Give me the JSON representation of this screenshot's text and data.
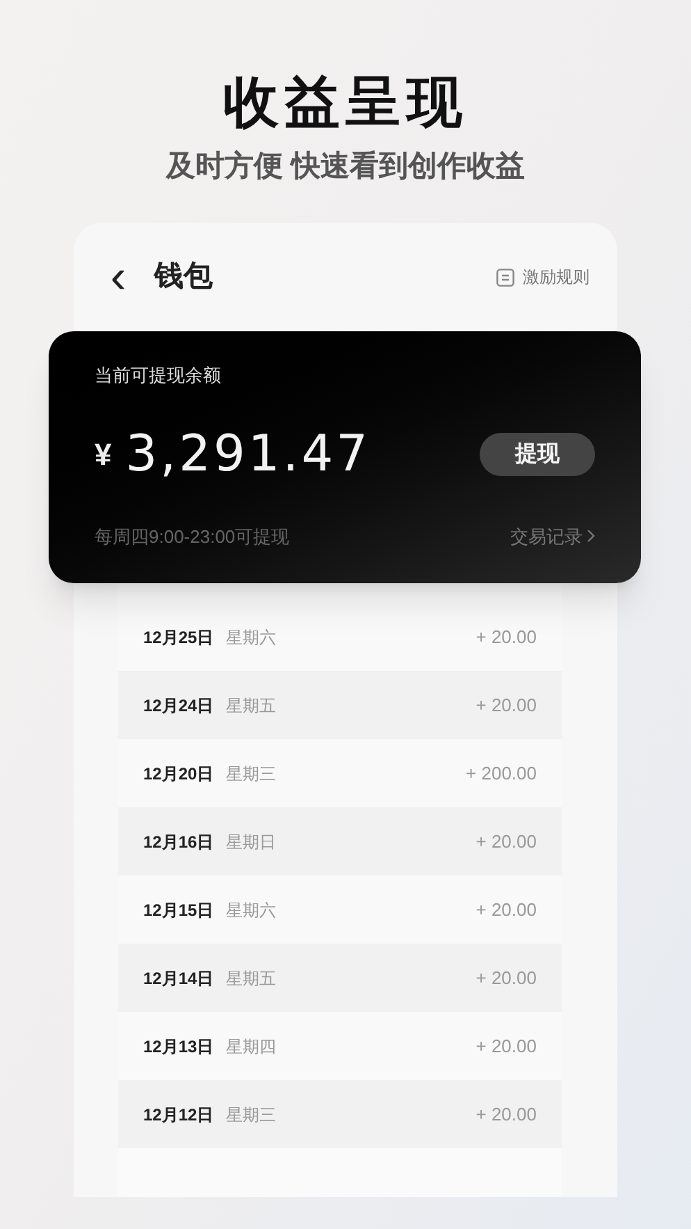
{
  "headline": "收益呈现",
  "subtitle": "及时方便 快速看到创作收益",
  "header": {
    "back_icon": "‹",
    "title": "钱包",
    "rules_link": "激励规则"
  },
  "balance_card": {
    "label": "当前可提现余额",
    "currency": "¥",
    "amount": "3,291.47",
    "withdraw_button": "提现",
    "note": "每周四9:00-23:00可提现",
    "records_link": "交易记录"
  },
  "transactions": [
    {
      "date": "12月25日",
      "weekday": "星期六",
      "amount": "+ 20.00"
    },
    {
      "date": "12月24日",
      "weekday": "星期五",
      "amount": "+ 20.00"
    },
    {
      "date": "12月20日",
      "weekday": "星期三",
      "amount": "+ 200.00"
    },
    {
      "date": "12月16日",
      "weekday": "星期日",
      "amount": "+ 20.00"
    },
    {
      "date": "12月15日",
      "weekday": "星期六",
      "amount": "+ 20.00"
    },
    {
      "date": "12月14日",
      "weekday": "星期五",
      "amount": "+ 20.00"
    },
    {
      "date": "12月13日",
      "weekday": "星期四",
      "amount": "+ 20.00"
    },
    {
      "date": "12月12日",
      "weekday": "星期三",
      "amount": "+ 20.00"
    }
  ]
}
